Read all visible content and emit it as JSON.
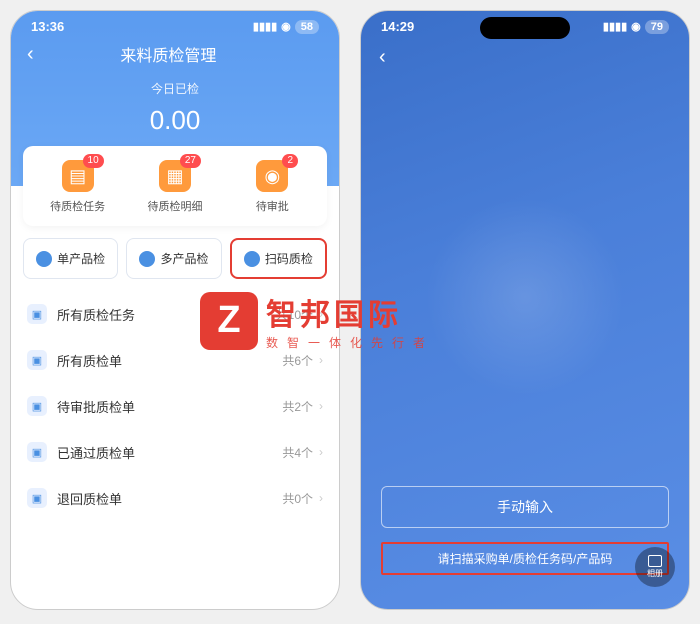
{
  "phone1": {
    "statusbar": {
      "time": "13:36",
      "battery": "58"
    },
    "header": {
      "title": "来料质检管理",
      "subtitle": "今日已检",
      "value": "0.00"
    },
    "cards": [
      {
        "label": "待质检任务",
        "badge": "10"
      },
      {
        "label": "待质检明细",
        "badge": "27"
      },
      {
        "label": "待审批",
        "badge": "2"
      }
    ],
    "buttons": [
      {
        "label": "单产品检",
        "highlighted": false
      },
      {
        "label": "多产品检",
        "highlighted": false
      },
      {
        "label": "扫码质检",
        "highlighted": true
      }
    ],
    "list": [
      {
        "label": "所有质检任务",
        "count": "共10个"
      },
      {
        "label": "所有质检单",
        "count": "共6个"
      },
      {
        "label": "待审批质检单",
        "count": "共2个"
      },
      {
        "label": "已通过质检单",
        "count": "共4个"
      },
      {
        "label": "退回质检单",
        "count": "共0个"
      }
    ]
  },
  "phone2": {
    "statusbar": {
      "time": "14:29",
      "battery": "79"
    },
    "manual_label": "手动输入",
    "scan_hint": "请扫描采购单/质检任务码/产品码",
    "album_label": "相册"
  },
  "watermark": {
    "logo": "Z",
    "main": "智邦国际",
    "sub": "数智一体化先行者"
  }
}
